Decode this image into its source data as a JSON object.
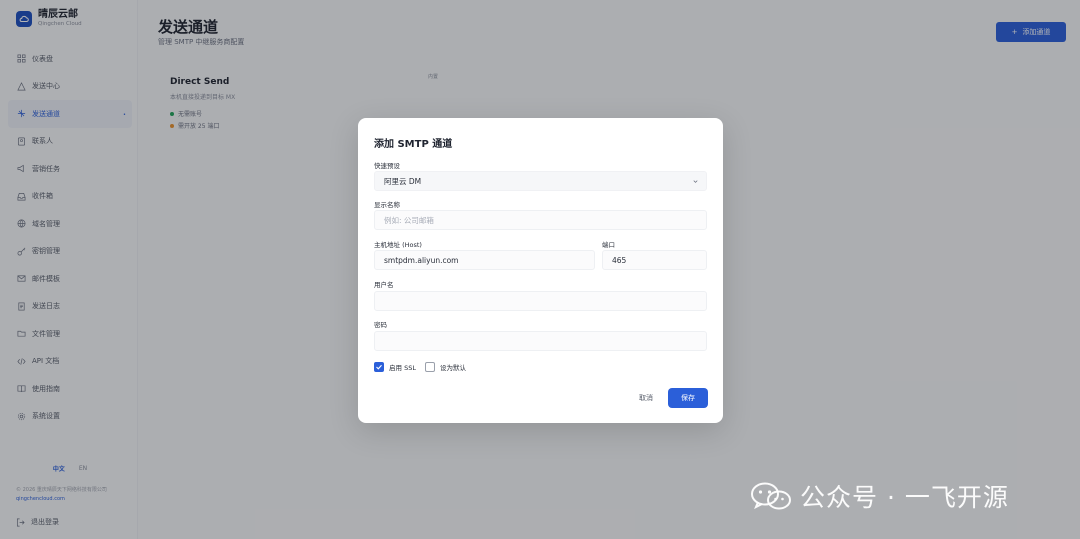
{
  "brand": {
    "name": "晴辰云邮",
    "sub": "Qingchen Cloud"
  },
  "sidebar": {
    "items": [
      {
        "label": "仪表盘",
        "icon": "dashboard-icon"
      },
      {
        "label": "发送中心",
        "icon": "send-icon"
      },
      {
        "label": "发送通道",
        "icon": "channel-icon",
        "active": true,
        "marker": "•"
      },
      {
        "label": "联系人",
        "icon": "contacts-icon"
      },
      {
        "label": "营销任务",
        "icon": "campaign-icon"
      },
      {
        "label": "收件箱",
        "icon": "inbox-icon"
      },
      {
        "label": "域名管理",
        "icon": "globe-icon"
      },
      {
        "label": "密钥管理",
        "icon": "key-icon"
      },
      {
        "label": "邮件模板",
        "icon": "template-icon"
      },
      {
        "label": "发送日志",
        "icon": "log-icon"
      },
      {
        "label": "文件管理",
        "icon": "folder-icon"
      },
      {
        "label": "API 文档",
        "icon": "code-icon"
      },
      {
        "label": "使用指南",
        "icon": "book-icon"
      },
      {
        "label": "系统设置",
        "icon": "gear-icon"
      }
    ],
    "lang": {
      "zh": "中文",
      "en": "EN"
    },
    "copyright": "© 2026 重庆晴辰天下网络科技有限公司",
    "site": "qingchencloud.com",
    "logout": "退出登录"
  },
  "header": {
    "title": "发送通道",
    "subtitle": "管理 SMTP 中继服务商配置",
    "add_button": "添加通道",
    "add_icon": "plus-icon"
  },
  "card": {
    "title": "Direct Send",
    "desc": "本机直接投递到目标 MX",
    "tag": "内置",
    "features": [
      {
        "text": "无需账号",
        "color": "#22a35a"
      },
      {
        "text": "需开放 25 端口",
        "color": "#e8912d"
      }
    ]
  },
  "modal": {
    "title": "添加 SMTP 通道",
    "preset": {
      "label": "快速预设",
      "value": "阿里云 DM"
    },
    "display_name": {
      "label": "显示名称",
      "placeholder": "例如: 公司邮箱",
      "value": ""
    },
    "host": {
      "label": "主机地址 (Host)",
      "value": "smtpdm.aliyun.com"
    },
    "port": {
      "label": "端口",
      "value": "465"
    },
    "username": {
      "label": "用户名",
      "value": ""
    },
    "password": {
      "label": "密码",
      "value": ""
    },
    "ssl": {
      "label": "启用 SSL",
      "checked": true
    },
    "default": {
      "label": "设为默认",
      "checked": false
    },
    "cancel": "取消",
    "save": "保存"
  },
  "watermark": {
    "text": "公众号 · 一飞开源",
    "icon": "wechat-icon"
  }
}
